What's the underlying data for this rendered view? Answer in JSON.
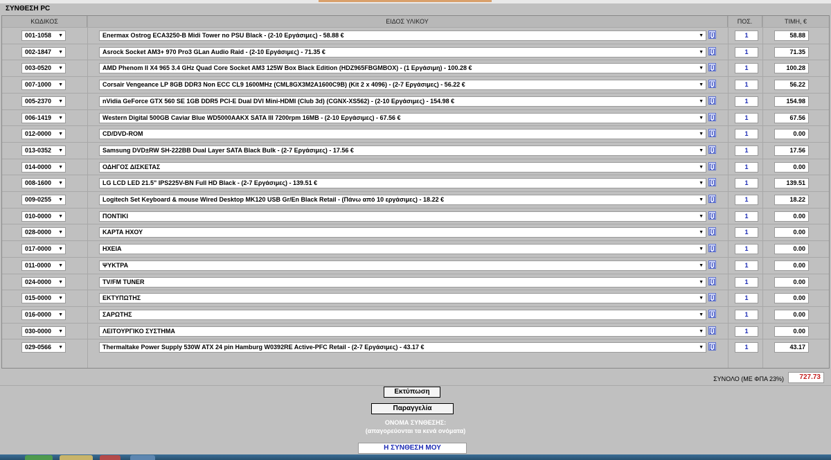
{
  "title": "ΣΥΝΘΕΣΗ PC",
  "headers": {
    "code": "ΚΩΔΙΚΟΣ",
    "item": "ΕΙΔΟΣ ΥΛΙΚΟΥ",
    "qty": "ΠΟΣ.",
    "price": "ΤΙΜΗ, €"
  },
  "info_label": "[i]",
  "rows": [
    {
      "code": "001-1058",
      "item": "Enermax Ostrog ECA3250-B Midi Tower no PSU Black - (2-10 Εργάσιμες) - 58.88 €",
      "qty": "1",
      "price": "58.88"
    },
    {
      "code": "002-1847",
      "item": "Asrock Socket AM3+ 970 Pro3 GLan Audio Raid - (2-10 Εργάσιμες) - 71.35 €",
      "qty": "1",
      "price": "71.35"
    },
    {
      "code": "003-0520",
      "item": "AMD Phenom II X4 965 3.4 GHz Quad Core Socket AM3 125W Box Black Edition (HDZ965FBGMBOX) - (1 Εργάσιμη) - 100.28 €",
      "qty": "1",
      "price": "100.28"
    },
    {
      "code": "007-1000",
      "item": "Corsair Vengeance LP 8GB DDR3 Non ECC CL9 1600MHz (CML8GX3M2A1600C9B) (Kit 2 x 4096) - (2-7 Εργάσιμες) - 56.22 €",
      "qty": "1",
      "price": "56.22"
    },
    {
      "code": "005-2370",
      "item": "nVidia GeForce GTX 560 SE 1GB DDR5 PCI-E Dual DVI Mini-HDMI (Club 3d) (CGNX-XS562) - (2-10 Εργάσιμες) - 154.98 €",
      "qty": "1",
      "price": "154.98"
    },
    {
      "code": "006-1419",
      "item": "Western Digital 500GB Caviar Blue WD5000AAKX SATA III 7200rpm 16MB - (2-10 Εργάσιμες) - 67.56 €",
      "qty": "1",
      "price": "67.56"
    },
    {
      "code": "012-0000",
      "item": "CD/DVD-ROM",
      "qty": "1",
      "price": "0.00"
    },
    {
      "code": "013-0352",
      "item": "Samsung DVD±RW SH-222BB Dual Layer SATA Black Bulk - (2-7 Εργάσιμες) - 17.56 €",
      "qty": "1",
      "price": "17.56"
    },
    {
      "code": "014-0000",
      "item": "ΟΔΗΓΟΣ ΔΙΣΚΕΤΑΣ",
      "qty": "1",
      "price": "0.00"
    },
    {
      "code": "008-1600",
      "item": "LG LCD LED 21.5\" IPS225V-BN Full HD Black - (2-7 Εργάσιμες) - 139.51 €",
      "qty": "1",
      "price": "139.51"
    },
    {
      "code": "009-0255",
      "item": "Logitech Set Keyboard & mouse Wired Desktop MK120 USB Gr/En Black Retail - (Πάνω από 10 εργάσιμες) - 18.22 €",
      "qty": "1",
      "price": "18.22"
    },
    {
      "code": "010-0000",
      "item": "ΠΟΝΤΙΚΙ",
      "qty": "1",
      "price": "0.00"
    },
    {
      "code": "028-0000",
      "item": "ΚΑΡΤΑ ΗΧΟΥ",
      "qty": "1",
      "price": "0.00"
    },
    {
      "code": "017-0000",
      "item": "ΗΧΕΙΑ",
      "qty": "1",
      "price": "0.00"
    },
    {
      "code": "011-0000",
      "item": "ΨΥΚΤΡΑ",
      "qty": "1",
      "price": "0.00"
    },
    {
      "code": "024-0000",
      "item": "TV/FM TUNER",
      "qty": "1",
      "price": "0.00"
    },
    {
      "code": "015-0000",
      "item": "ΕΚΤΥΠΩΤΗΣ",
      "qty": "1",
      "price": "0.00"
    },
    {
      "code": "016-0000",
      "item": "ΣΑΡΩΤΗΣ",
      "qty": "1",
      "price": "0.00"
    },
    {
      "code": "030-0000",
      "item": "ΛΕΙΤΟΥΡΓΙΚΟ ΣΥΣΤΗΜΑ",
      "qty": "1",
      "price": "0.00"
    },
    {
      "code": "029-0566",
      "item": "Thermaltake Power Supply 530W ATX 24 pin Hamburg W0392RE Active-PFC Retail - (2-7 Εργάσιμες) - 43.17 €",
      "qty": "1",
      "price": "43.17"
    }
  ],
  "total": {
    "label": "ΣΥΝΟΛΟ (ΜΕ ΦΠΑ 23%)",
    "value": "727.73"
  },
  "buttons": {
    "print": "Εκτύπωση",
    "order": "Παραγγελία"
  },
  "build_name": {
    "label": "ΟΝΟΜΑ ΣΥΝΘΕΣΗΣ:",
    "hint": "(απαγορεύονται τα κενά ονόματα)",
    "value": "Η ΣΥΝΘΕΣΗ ΜΟΥ"
  },
  "colors": {
    "background": "#c0c0c0",
    "total_value": "#c42020",
    "qty_text": "#1c2bb5"
  }
}
